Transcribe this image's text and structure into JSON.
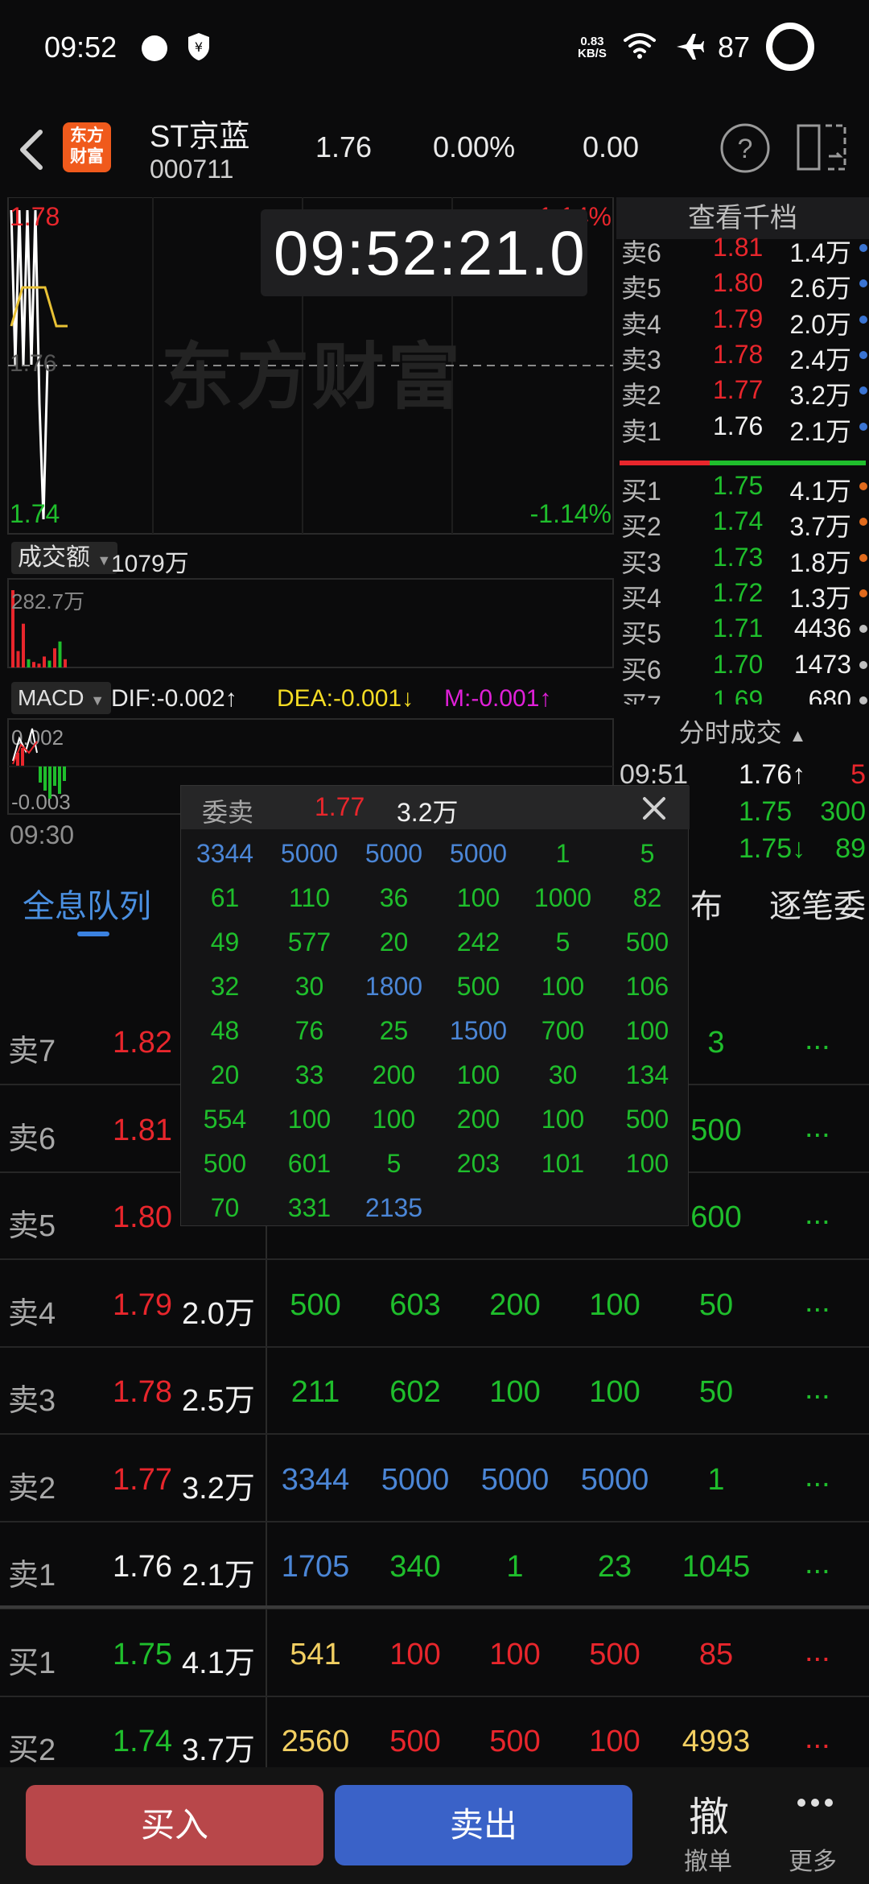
{
  "status_bar": {
    "time": "09:52",
    "net_speed_value": "0.83",
    "net_speed_unit": "KB/S",
    "battery": "87"
  },
  "header": {
    "logo_line1": "东方",
    "logo_line2": "财富",
    "name": "ST京蓝",
    "code": "000711",
    "price": "1.76",
    "change_pct": "0.00%",
    "change": "0.00"
  },
  "chart": {
    "price_high": "1.78",
    "price_mid": "1.76",
    "price_low": "1.74",
    "pct_high": "1.14%",
    "pct_low": "-1.14%",
    "watermark": "东方财富",
    "timestamp": "09:52:21.0",
    "volume_label": "成交额",
    "volume_value": "1079万",
    "volume_max": "282.7万",
    "macd_label": "MACD",
    "dif": "DIF:-0.002↑",
    "dea": "DEA:-0.001↓",
    "m": "M:-0.001↑",
    "macd_top": "0.002",
    "macd_bottom": "-0.003",
    "time_start": "09:30",
    "price_series": [
      1.78,
      1.76,
      1.78,
      1.76,
      1.78,
      1.76,
      1.78,
      1.755,
      1.74,
      1.76
    ],
    "avg_series": [
      1.765,
      1.77,
      1.77,
      1.77,
      1.765,
      1.765
    ],
    "volume_bars": [
      {
        "v": 282.7,
        "c": "red"
      },
      {
        "v": 60,
        "c": "red"
      },
      {
        "v": 160,
        "c": "red"
      },
      {
        "v": 30,
        "c": "green"
      },
      {
        "v": 20,
        "c": "red"
      },
      {
        "v": 14,
        "c": "red"
      },
      {
        "v": 40,
        "c": "red"
      },
      {
        "v": 25,
        "c": "green"
      },
      {
        "v": 70,
        "c": "red"
      },
      {
        "v": 95,
        "c": "green"
      },
      {
        "v": 30,
        "c": "red"
      }
    ]
  },
  "order_book": {
    "title": "查看千档",
    "asks": [
      {
        "label": "卖6",
        "price": "1.81",
        "vol": "1.4万",
        "pc": "red",
        "dot": "#3a74d2"
      },
      {
        "label": "卖5",
        "price": "1.80",
        "vol": "2.6万",
        "pc": "red",
        "dot": "#3a74d2"
      },
      {
        "label": "卖4",
        "price": "1.79",
        "vol": "2.0万",
        "pc": "red",
        "dot": "#3a74d2"
      },
      {
        "label": "卖3",
        "price": "1.78",
        "vol": "2.4万",
        "pc": "red",
        "dot": "#3a74d2"
      },
      {
        "label": "卖2",
        "price": "1.77",
        "vol": "3.2万",
        "pc": "red",
        "dot": "#3a74d2"
      },
      {
        "label": "卖1",
        "price": "1.76",
        "vol": "2.1万",
        "pc": "white",
        "dot": "#3a74d2"
      }
    ],
    "bids": [
      {
        "label": "买1",
        "price": "1.75",
        "vol": "4.1万",
        "pc": "green",
        "dot": "#e06a1c"
      },
      {
        "label": "买2",
        "price": "1.74",
        "vol": "3.7万",
        "pc": "green",
        "dot": "#e06a1c"
      },
      {
        "label": "买3",
        "price": "1.73",
        "vol": "1.8万",
        "pc": "green",
        "dot": "#e06a1c"
      },
      {
        "label": "买4",
        "price": "1.72",
        "vol": "1.3万",
        "pc": "green",
        "dot": "#e06a1c"
      },
      {
        "label": "买5",
        "price": "1.71",
        "vol": "4436",
        "pc": "green",
        "dot": "#bfbfbf"
      },
      {
        "label": "买6",
        "price": "1.70",
        "vol": "1473",
        "pc": "green",
        "dot": "#bfbfbf"
      },
      {
        "label": "买7",
        "price": "1.69",
        "vol": "680",
        "pc": "green",
        "dot": "#bfbfbf"
      }
    ]
  },
  "ticks": {
    "title": "分时成交",
    "rows": [
      {
        "time": "09:51",
        "price": "1.76↑",
        "pc": "white",
        "vol": "5",
        "vc": "red"
      },
      {
        "time": "",
        "price": "1.75",
        "pc": "green",
        "vol": "300",
        "vc": "green"
      },
      {
        "time": "",
        "price": "1.75↓",
        "pc": "green",
        "vol": "89",
        "vc": "green"
      }
    ]
  },
  "tabs": {
    "queue": "全息队列",
    "dist": "布",
    "each": "逐笔委"
  },
  "queue": [
    {
      "label": "卖7",
      "price": "1.82",
      "pc": "red",
      "vol": "",
      "cells": [],
      "more": "..."
    },
    {
      "label": "卖6",
      "price": "1.81",
      "pc": "red",
      "vol": "",
      "cells": [],
      "more": "..."
    },
    {
      "label": "卖5",
      "price": "1.80",
      "pc": "red",
      "vol": "",
      "cells": [],
      "more": "..."
    },
    {
      "label": "卖4",
      "price": "1.79",
      "pc": "red",
      "vol": "2.0万",
      "cells": [
        [
          "500",
          "green"
        ],
        [
          "603",
          "green"
        ],
        [
          "200",
          "green"
        ],
        [
          "100",
          "green"
        ],
        [
          "50",
          "green"
        ]
      ],
      "more": "..."
    },
    {
      "label": "卖3",
      "price": "1.78",
      "pc": "red",
      "vol": "2.5万",
      "cells": [
        [
          "211",
          "green"
        ],
        [
          "602",
          "green"
        ],
        [
          "100",
          "green"
        ],
        [
          "100",
          "green"
        ],
        [
          "50",
          "green"
        ]
      ],
      "more": "..."
    },
    {
      "label": "卖2",
      "price": "1.77",
      "pc": "red",
      "vol": "3.2万",
      "cells": [
        [
          "3344",
          "blue"
        ],
        [
          "5000",
          "blue"
        ],
        [
          "5000",
          "blue"
        ],
        [
          "5000",
          "blue"
        ],
        [
          "1",
          "green"
        ]
      ],
      "more": "..."
    },
    {
      "label": "卖1",
      "price": "1.76",
      "pc": "white",
      "vol": "2.1万",
      "cells": [
        [
          "1705",
          "blue"
        ],
        [
          "340",
          "green"
        ],
        [
          "1",
          "green"
        ],
        [
          "23",
          "green"
        ],
        [
          "1045",
          "green"
        ]
      ],
      "more": "..."
    },
    {
      "label": "买1",
      "price": "1.75",
      "pc": "green",
      "vol": "4.1万",
      "cells": [
        [
          "541",
          "yellow"
        ],
        [
          "100",
          "red"
        ],
        [
          "100",
          "red"
        ],
        [
          "500",
          "red"
        ],
        [
          "85",
          "red"
        ]
      ],
      "more": "..."
    },
    {
      "label": "买2",
      "price": "1.74",
      "pc": "green",
      "vol": "3.7万",
      "cells": [
        [
          "2560",
          "yellow"
        ],
        [
          "500",
          "red"
        ],
        [
          "500",
          "red"
        ],
        [
          "100",
          "red"
        ],
        [
          "4993",
          "yellow"
        ]
      ],
      "more": "..."
    }
  ],
  "queue_partial": {
    "r7_c5": "3",
    "r6_c5": "500",
    "r5_c5": "600"
  },
  "popup": {
    "label": "委卖",
    "price": "1.77",
    "vol": "3.2万",
    "grid": [
      [
        [
          "3344",
          "blue"
        ],
        [
          "5000",
          "blue"
        ],
        [
          "5000",
          "blue"
        ],
        [
          "5000",
          "blue"
        ],
        [
          "1",
          "green"
        ],
        [
          "5",
          "green"
        ]
      ],
      [
        [
          "61",
          "green"
        ],
        [
          "110",
          "green"
        ],
        [
          "36",
          "green"
        ],
        [
          "100",
          "green"
        ],
        [
          "1000",
          "green"
        ],
        [
          "82",
          "green"
        ]
      ],
      [
        [
          "49",
          "green"
        ],
        [
          "577",
          "green"
        ],
        [
          "20",
          "green"
        ],
        [
          "242",
          "green"
        ],
        [
          "5",
          "green"
        ],
        [
          "500",
          "green"
        ]
      ],
      [
        [
          "32",
          "green"
        ],
        [
          "30",
          "green"
        ],
        [
          "1800",
          "blue"
        ],
        [
          "500",
          "green"
        ],
        [
          "100",
          "green"
        ],
        [
          "106",
          "green"
        ]
      ],
      [
        [
          "48",
          "green"
        ],
        [
          "76",
          "green"
        ],
        [
          "25",
          "green"
        ],
        [
          "1500",
          "blue"
        ],
        [
          "700",
          "green"
        ],
        [
          "100",
          "green"
        ]
      ],
      [
        [
          "20",
          "green"
        ],
        [
          "33",
          "green"
        ],
        [
          "200",
          "green"
        ],
        [
          "100",
          "green"
        ],
        [
          "30",
          "green"
        ],
        [
          "134",
          "green"
        ]
      ],
      [
        [
          "554",
          "green"
        ],
        [
          "100",
          "green"
        ],
        [
          "100",
          "green"
        ],
        [
          "200",
          "green"
        ],
        [
          "100",
          "green"
        ],
        [
          "500",
          "green"
        ]
      ],
      [
        [
          "500",
          "green"
        ],
        [
          "601",
          "green"
        ],
        [
          "5",
          "green"
        ],
        [
          "203",
          "green"
        ],
        [
          "101",
          "green"
        ],
        [
          "100",
          "green"
        ]
      ],
      [
        [
          "70",
          "green"
        ],
        [
          "331",
          "green"
        ],
        [
          "2135",
          "blue"
        ]
      ]
    ]
  },
  "bottom_bar": {
    "buy": "买入",
    "sell": "卖出",
    "cancel_icon": "撤",
    "cancel": "撤单",
    "more": "更多"
  }
}
